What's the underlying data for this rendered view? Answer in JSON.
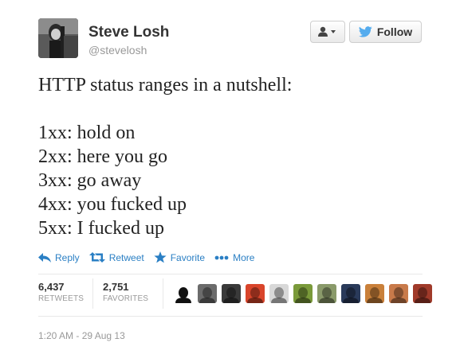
{
  "author": {
    "name": "Steve Losh",
    "handle": "@stevelosh"
  },
  "header": {
    "follow_label": "Follow",
    "user_menu_icon": "user-dropdown-icon",
    "follow_icon": "twitter-bird-icon"
  },
  "tweet": {
    "lines": [
      "HTTP status ranges in a nutshell:",
      "",
      "1xx: hold on",
      "2xx: here you go",
      "3xx: go away",
      "4xx: you fucked up",
      "5xx: I fucked up"
    ]
  },
  "actions": {
    "reply": "Reply",
    "retweet": "Retweet",
    "favorite": "Favorite",
    "more": "More"
  },
  "stats": {
    "retweets_count": "6,437",
    "retweets_label": "RETWEETS",
    "favorites_count": "2,751",
    "favorites_label": "FAVORITES"
  },
  "faces": [
    {
      "name": "favoriter-avatar-1",
      "color": "#ffffff"
    },
    {
      "name": "favoriter-avatar-2",
      "color": "#6b6b6b"
    },
    {
      "name": "favoriter-avatar-3",
      "color": "#3a3a3a"
    },
    {
      "name": "favoriter-avatar-4",
      "color": "#d9452b"
    },
    {
      "name": "favoriter-avatar-5",
      "color": "#d8d8d8"
    },
    {
      "name": "favoriter-avatar-6",
      "color": "#7a9a3a"
    },
    {
      "name": "favoriter-avatar-7",
      "color": "#8a9a6a"
    },
    {
      "name": "favoriter-avatar-8",
      "color": "#2a3a5a"
    },
    {
      "name": "favoriter-avatar-9",
      "color": "#c9803a"
    },
    {
      "name": "favoriter-avatar-10",
      "color": "#c87a4a"
    },
    {
      "name": "favoriter-avatar-11",
      "color": "#a03a2a"
    }
  ],
  "timestamp": "1:20 AM - 29 Aug 13",
  "colors": {
    "link_blue": "#2a7fc4",
    "twitter_blue": "#55acee"
  }
}
